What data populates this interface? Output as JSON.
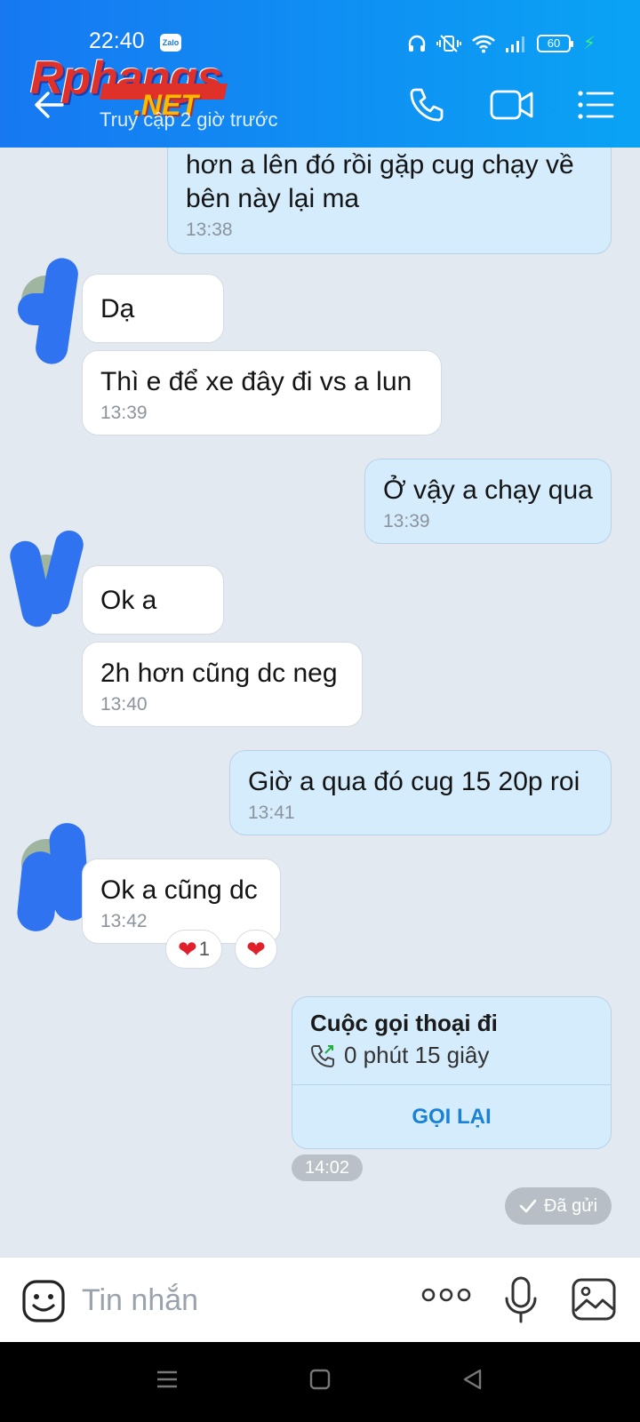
{
  "status_bar": {
    "time": "22:40",
    "app_badge": "Zalo",
    "battery": "60"
  },
  "header": {
    "watermark_main": "Rphangs",
    "watermark_sub": ".NET",
    "subtitle": "Truy cập 2 giờ trước",
    "icons": [
      "back-arrow-icon",
      "phone-icon",
      "video-call-icon",
      "menu-list-icon"
    ]
  },
  "messages": [
    {
      "dir": "out",
      "text": "hơn a lên đó rồi gặp cug chạy về bên này lại ma",
      "time": "13:38"
    },
    {
      "dir": "in",
      "text": "Dạ",
      "time": ""
    },
    {
      "dir": "in",
      "text": "Thì e để xe đây đi vs a lun",
      "time": "13:39"
    },
    {
      "dir": "out",
      "text": "Ở vậy a chạy qua",
      "time": "13:39"
    },
    {
      "dir": "in",
      "text": "Ok a",
      "time": ""
    },
    {
      "dir": "in",
      "text": "2h hơn cũng dc neg",
      "time": "13:40"
    },
    {
      "dir": "out",
      "text": "Giờ a qua đó cug 15 20p roi",
      "time": "13:41"
    },
    {
      "dir": "in",
      "text": "Ok a cũng dc",
      "time": "13:42"
    }
  ],
  "reactions": {
    "count": "1"
  },
  "call_card": {
    "title": "Cuộc gọi thoại đi",
    "duration": "0 phút 15 giây",
    "action": "GỌI LẠI",
    "time": "14:02"
  },
  "sent_status": "Đã gửi",
  "input": {
    "placeholder": "Tin nhắn"
  },
  "colors": {
    "header_blue": "#1778f2",
    "bubble_out": "#d4ecfc",
    "bubble_in": "#ffffff",
    "chat_bg": "#e2e9f1",
    "link_blue": "#1a82d6"
  }
}
